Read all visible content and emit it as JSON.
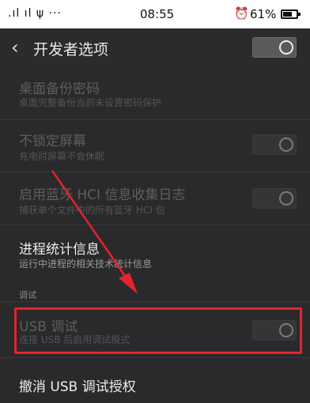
{
  "status_bar": {
    "signal": ".ıl ıl ψ ···",
    "time": "08:55",
    "alarm_icon": "alarm-clock-icon",
    "battery": "61%"
  },
  "app_bar": {
    "back_icon": "chevron-left-icon",
    "title": "开发者选项"
  },
  "settings": [
    {
      "title": "桌面备份密码",
      "subtitle": "桌面完整备份当前未设置密码保护",
      "enabled": false
    },
    {
      "title": "不锁定屏幕",
      "subtitle": "充电时屏幕不会休眠",
      "enabled": false,
      "toggle": "off"
    },
    {
      "title": "启用蓝牙 HCI 信息收集日志",
      "subtitle": "捕获单个文件中的所有蓝牙 HCI 包",
      "enabled": false,
      "toggle": "off"
    },
    {
      "title": "进程统计信息",
      "subtitle": "运行中进程的相关技术统计信息",
      "enabled": true
    }
  ],
  "section_header": "调试",
  "usb_debugging": {
    "title": "USB 调试",
    "subtitle": "连接 USB 后启用调试模式",
    "enabled": false,
    "toggle": "off"
  },
  "revoke_usb": {
    "title": "撤消 USB 调试授权"
  },
  "annotation_color": "#e3242b"
}
